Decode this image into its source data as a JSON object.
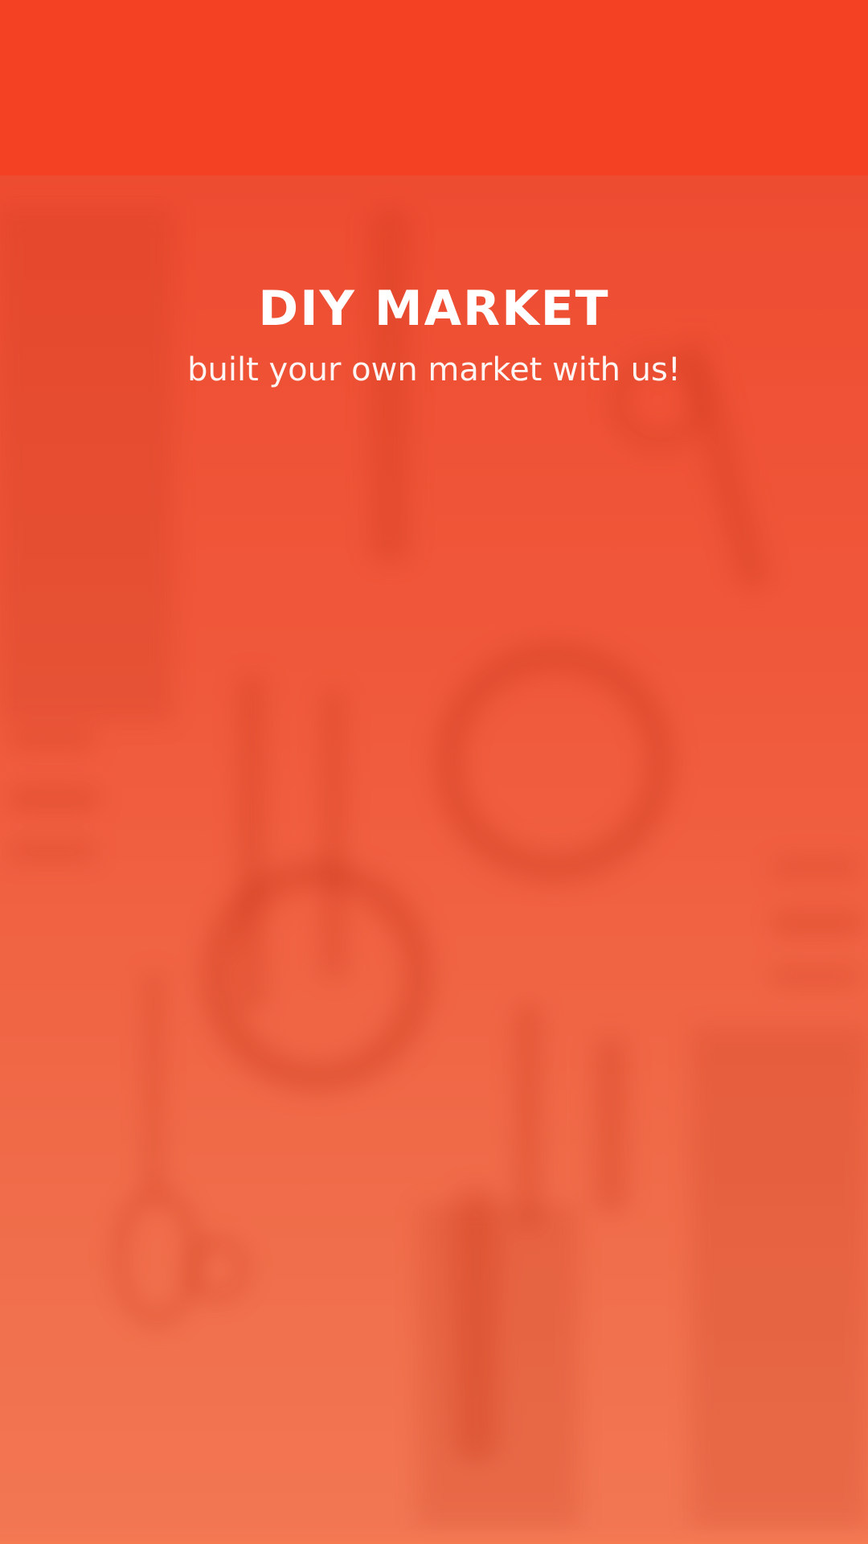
{
  "splash": {
    "title": "DIY MARKET",
    "subtitle": "built your own market with us!"
  },
  "colors": {
    "status_bar": "#f44124",
    "background_top": "#ee4c31",
    "background_bottom": "#f27753",
    "text": "#ffffff"
  },
  "icons": [
    "scissors-icon",
    "embroidery-hoop-icon",
    "thread-spool-icon",
    "pencil-icon"
  ]
}
